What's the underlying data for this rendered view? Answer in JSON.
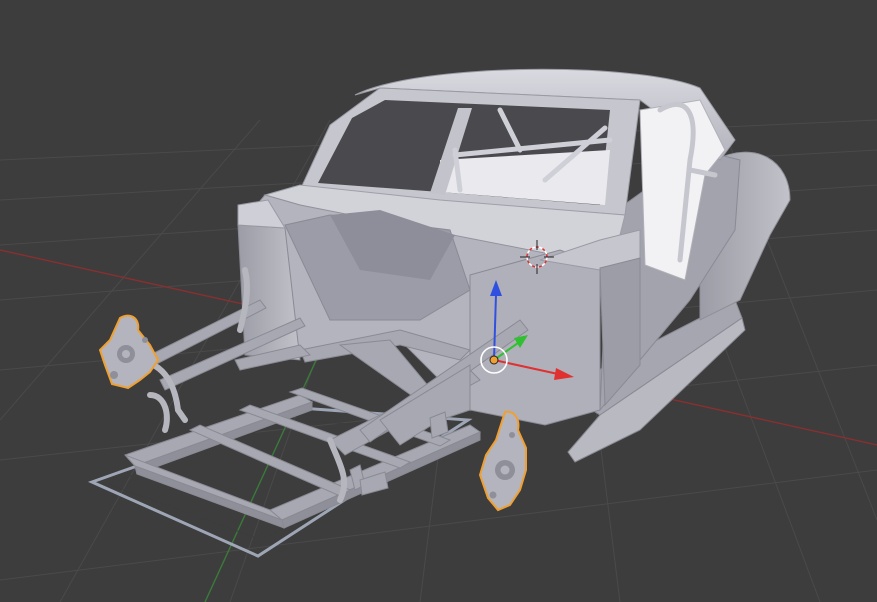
{
  "viewport": {
    "background_color": "#3d3d3d",
    "grid_line_color": "#4a4a4a",
    "x_axis_color": "#8a2f2f",
    "y_axis_color": "#3b7a3b",
    "model_color": "#b6b6be",
    "model_shadow_color": "#8f8f99",
    "model_highlight_color": "#d9d9e0",
    "interior_color": "#f2f2f4",
    "selected_outline_color": "#f0a030"
  },
  "gizmo": {
    "x_axis_color": "#e03030",
    "y_axis_color": "#30c030",
    "z_axis_color": "#3050e0",
    "center_color": "#f0a030",
    "ring_color": "#ffffff",
    "icons": [
      "translate-manipulator-icon",
      "3d-cursor-icon"
    ]
  }
}
